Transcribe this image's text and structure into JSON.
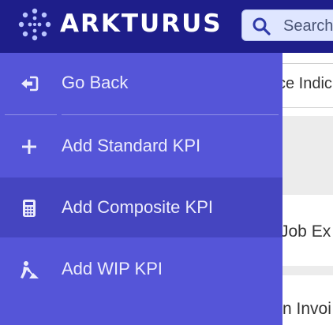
{
  "header": {
    "brand": "ARKTURUS",
    "search_placeholder": "Search"
  },
  "background": {
    "tab_fragment": "ce Indic",
    "card1_fragment": "Job Ex",
    "card2_fragment": "n Invoi"
  },
  "menu": {
    "items": [
      {
        "label": "Go Back",
        "icon": "arrow-left-from-bracket-icon"
      },
      {
        "label": "Add Standard KPI",
        "icon": "plus-icon"
      },
      {
        "label": "Add Composite KPI",
        "icon": "calculator-icon",
        "active": true
      },
      {
        "label": "Add WIP KPI",
        "icon": "person-digging-icon"
      }
    ]
  },
  "colors": {
    "header_bg": "#1e1e8a",
    "menu_bg": "#5555d8",
    "menu_active_bg": "#4545c0",
    "search_bg": "#dfe6ff"
  }
}
